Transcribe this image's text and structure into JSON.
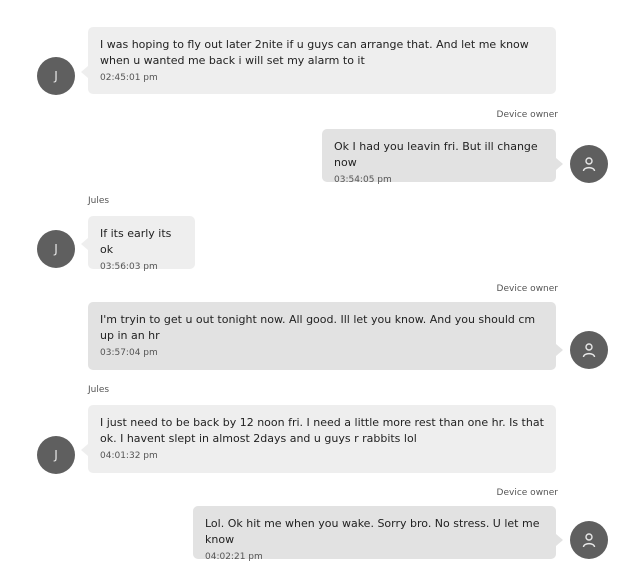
{
  "conversation": {
    "messages": [
      {
        "direction": "incoming",
        "sender": "",
        "avatar_letter": "J",
        "text": "I was hoping to fly out later 2nite if u guys can arrange that. And let me know when u wanted me back i will set my alarm to it",
        "time": "02:45:01 pm"
      },
      {
        "direction": "outgoing",
        "sender": "Device owner",
        "avatar_icon": "person-icon",
        "text": "Ok I had you leavin fri. But ill change now",
        "time": "03:54:05 pm"
      },
      {
        "direction": "incoming",
        "sender": "Jules",
        "avatar_letter": "J",
        "text": "If its  early its ok",
        "time": "03:56:03 pm"
      },
      {
        "direction": "outgoing",
        "sender": "Device owner",
        "avatar_icon": "person-icon",
        "text": "I'm tryin to get u out tonight now. All good. Ill let you know. And you should cm up in an hr",
        "time": "03:57:04 pm"
      },
      {
        "direction": "incoming",
        "sender": "Jules",
        "avatar_letter": "J",
        "text": "I just need to be back by 12 noon fri. I need a little more rest than one hr. Is that ok. I havent slept in almost 2days and u guys r rabbits lol",
        "time": "04:01:32 pm"
      },
      {
        "direction": "outgoing",
        "sender": "Device owner",
        "avatar_icon": "person-icon",
        "text": "Lol. Ok hit me when you wake. Sorry bro. No stress. U let me know",
        "time": "04:02:21 pm"
      }
    ]
  },
  "colors": {
    "incoming_bubble": "#eeeeee",
    "outgoing_bubble": "#e2e2e2",
    "avatar": "#5f5f5f"
  }
}
